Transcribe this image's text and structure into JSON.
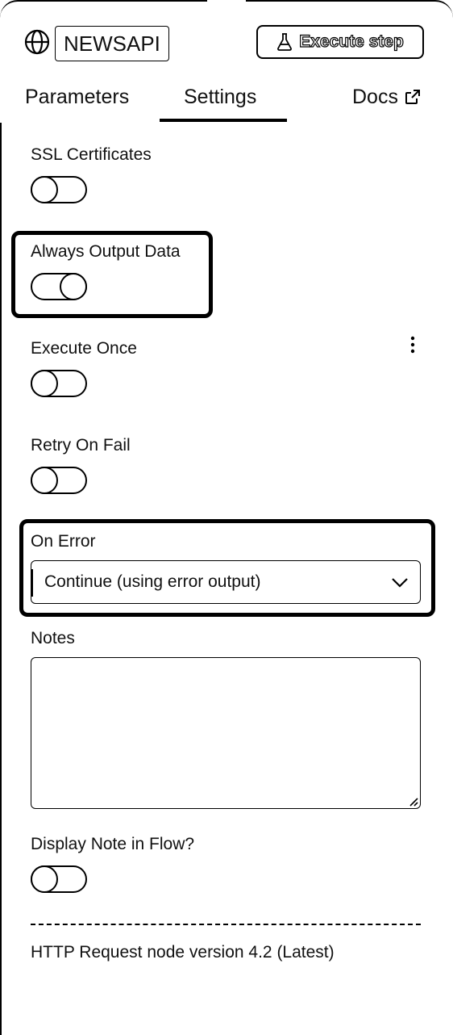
{
  "header": {
    "node_name": "NEWSAPI",
    "execute_label": "Execute step"
  },
  "tabs": [
    {
      "label": "Parameters",
      "active": false
    },
    {
      "label": "Settings",
      "active": true
    },
    {
      "label": "Docs",
      "active": false
    }
  ],
  "settings": {
    "ssl": {
      "label": "SSL Certificates",
      "enabled": false
    },
    "always_output": {
      "label": "Always Output Data",
      "enabled": true
    },
    "execute_once": {
      "label": "Execute Once",
      "enabled": false
    },
    "retry_on_fail": {
      "label": "Retry On Fail",
      "enabled": false
    },
    "on_error": {
      "label": "On Error",
      "selected": "Continue (using error output)"
    },
    "notes": {
      "label": "Notes",
      "value": ""
    },
    "display_note": {
      "label": "Display Note in Flow?",
      "enabled": false
    }
  },
  "footer": {
    "version_text": "HTTP Request node version 4.2 (Latest)"
  },
  "icons": [
    "globe-icon",
    "flask-icon",
    "external-link-icon",
    "kebab-menu-icon",
    "chevron-down-icon",
    "resize-handle-icon"
  ]
}
